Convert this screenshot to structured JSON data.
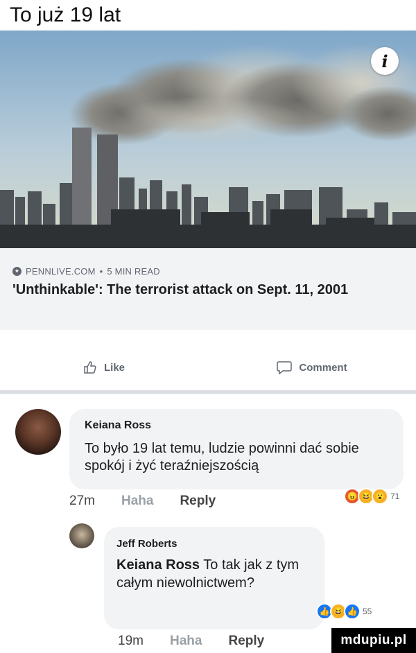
{
  "caption": "To już 19 lat",
  "link_preview": {
    "source": "PENNLIVE.COM",
    "read_time": "5 MIN READ",
    "separator": "•",
    "title": "'Unthinkable': The terrorist attack on Sept. 11, 2001"
  },
  "actions": {
    "like_label": "Like",
    "comment_label": "Comment"
  },
  "comments": [
    {
      "author": "Keiana Ross",
      "text": "To było 19 lat temu, ludzie powinni dać sobie spokój i żyć teraźniejszością",
      "time": "27m",
      "reaction_label": "Haha",
      "reply_label": "Reply",
      "reaction_count": "71"
    },
    {
      "author": "Jeff Roberts",
      "mention": "Keiana Ross",
      "text": "To tak jak z tym całym niewolnictwem?",
      "time": "19m",
      "reaction_label": "Haha",
      "reply_label": "Reply",
      "reaction_count": "55"
    }
  ],
  "watermark": "mdupiu.pl",
  "colors": {
    "bubble": "#f2f3f5",
    "meta_text": "#606770",
    "like_blue": "#1877f2",
    "angry": "#e4572e",
    "haha": "#f7b125"
  }
}
